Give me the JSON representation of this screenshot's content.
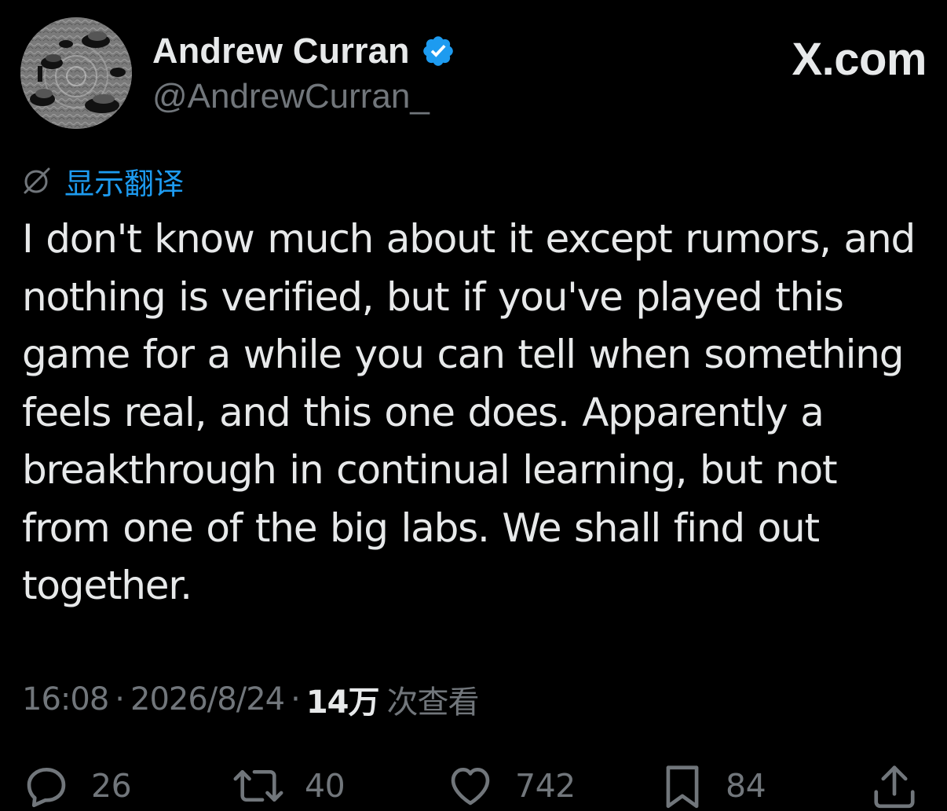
{
  "author": {
    "name": "Andrew Curran",
    "handle": "@AndrewCurran_",
    "verified_color": "#1d9bf0"
  },
  "brand": {
    "text": "X.com"
  },
  "translate": {
    "icon": "translate-icon",
    "label": "显示翻译",
    "color": "#1d9bf0"
  },
  "tweet": {
    "text": "I don't know much about it except rumors, and nothing is verified, but if you've played this game for a while you can tell when something feels real, and this one does. Apparently a breakthrough in continual learning, but not from one of the big labs. We shall find out together."
  },
  "meta": {
    "time": "16:08",
    "separator": "·",
    "date": "2026/8/24",
    "views_count": "14万",
    "views_label": "次查看"
  },
  "actions": {
    "replies": {
      "icon": "reply-icon",
      "count": "26"
    },
    "reposts": {
      "icon": "repost-icon",
      "count": "40"
    },
    "likes": {
      "icon": "like-icon",
      "count": "742"
    },
    "bookmarks": {
      "icon": "bookmark-icon",
      "count": "84"
    },
    "share": {
      "icon": "share-icon"
    }
  },
  "colors": {
    "background": "#000000",
    "text_primary": "#e7e9ea",
    "text_secondary": "#71767b",
    "accent": "#1d9bf0"
  }
}
